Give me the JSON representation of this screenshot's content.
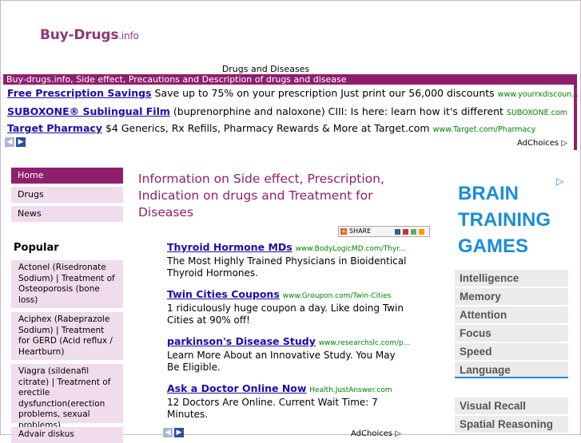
{
  "site": {
    "logo_main": "Buy-Drugs",
    "logo_suffix": ".info",
    "subtitle": "Drugs and Diseases",
    "tagline": "Buy-drugs.info, Side effect, Precautions and Description of drugs and disease"
  },
  "top_ads": [
    {
      "title": "Free Prescription Savings",
      "text": "Save up to 75% on your prescription Just print our 56,000 discounts",
      "url": "www.yourrxdiscoun..."
    },
    {
      "title": "SUBOXONE® Sublingual Film",
      "text": "(buprenorphine and naloxone) CIII: Is here: learn how it's different",
      "url": "SUBOXONE.com"
    },
    {
      "title": "Target Pharmacy",
      "text": "$4 Generics, Rx Refills, Pharmacy Rewards & More at Target.com",
      "url": "www.Target.com/Pharmacy"
    }
  ],
  "adchoices": "AdChoices",
  "nav": [
    {
      "label": "Home"
    },
    {
      "label": "Drugs"
    },
    {
      "label": "News"
    }
  ],
  "popular": {
    "title": "Popular",
    "items": [
      {
        "label": "Actonel (Risedronate Sodium) | Treatment of Osteoporosis (bone loss)"
      },
      {
        "label": "Aciphex (Rabeprazole Sodium) | Treatment for GERD (Acid reflux / Heartburn)"
      },
      {
        "label": "Viagra (sildenafil citrate) | Treatment of erectile dysfunction(erection problems, sexual problems)"
      },
      {
        "label": "Advair diskus"
      }
    ]
  },
  "main": {
    "heading": "Information on Side effect, Prescription, Indication on drugs and Treatment for Diseases",
    "share_label": "SHARE"
  },
  "content_ads": [
    {
      "title": "Thyroid Hormone MDs",
      "url": "www.BodyLogicMD.com/Thyr...",
      "text": "The Most Highly Trained Physicians in Bioidentical Thyroid Hormones."
    },
    {
      "title": "Twin Cities Coupons",
      "url": "www.Groupon.com/Twin-Cities",
      "text": "1 ridiculously huge coupon a day. Like doing Twin Cities at 90% off!"
    },
    {
      "title": "parkinson's Disease Study",
      "url": "www.researchslc.com/p...",
      "text": "Learn More About an Innovative Study. You May Be Eligible."
    },
    {
      "title": "Ask a Doctor Online Now",
      "url": "Health.JustAnswer.com",
      "text": "12 Doctors Are Online. Current Wait Time: 7 Minutes."
    }
  ],
  "brain_ad": {
    "lines": [
      "BRAIN",
      "TRAINING",
      "GAMES"
    ],
    "skills": [
      "Intelligence",
      "Memory",
      "Attention",
      "Focus",
      "Speed",
      "Language"
    ],
    "skills2": [
      "Visual Recall",
      "Spatial Reasoning"
    ]
  },
  "colors": {
    "brand": "#8f1f6e",
    "nav_bg": "#f0dcec",
    "brain_blue": "#1a8ed8",
    "ad_link": "#1a0dab",
    "ad_url": "#008000"
  }
}
